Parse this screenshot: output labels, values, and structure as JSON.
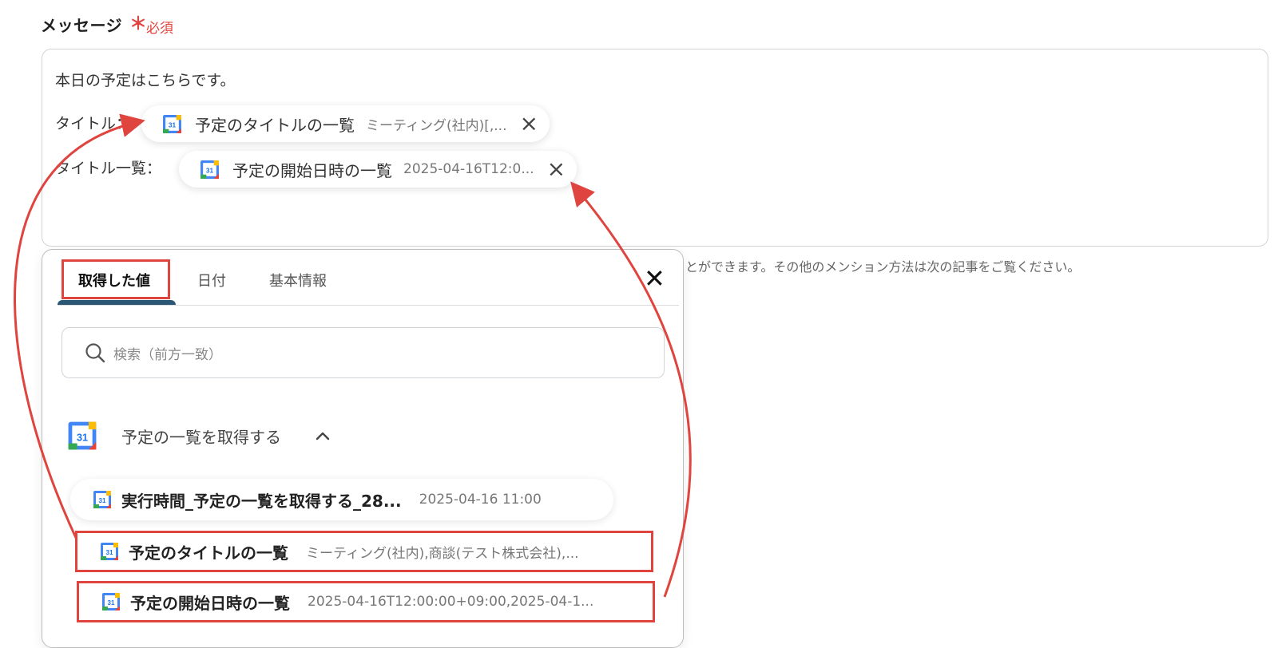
{
  "field": {
    "label": "メッセージ",
    "required_star": "＊",
    "required_text": "必須"
  },
  "editor": {
    "line1": "本日の予定はこちらです。",
    "row1_label": "タイトル：",
    "row2_label": "タイトル一覧：",
    "chips": [
      {
        "icon": "google-calendar-icon",
        "name": "予定のタイトルの一覧",
        "value": "ミーティング(社内)[,..."
      },
      {
        "icon": "google-calendar-icon",
        "name": "予定の開始日時の一覧",
        "value": "2025-04-16T12:0..."
      }
    ]
  },
  "helper_text": "とができます。その他のメンション方法は次の記事をご覧ください。",
  "panel": {
    "tabs": [
      {
        "label": "取得した値",
        "active": true
      },
      {
        "label": "日付",
        "active": false
      },
      {
        "label": "基本情報",
        "active": false
      }
    ],
    "close_icon": "close-icon",
    "search_placeholder": "検索（前方一致）",
    "section": {
      "icon_text": "31",
      "title": "予定の一覧を取得する",
      "expanded": true
    },
    "items": [
      {
        "name": "実行時間_予定の一覧を取得する_28...",
        "value": "2025-04-16 11:00",
        "highlighted": false
      },
      {
        "name": "予定のタイトルの一覧",
        "value": "ミーティング(社内),商談(テスト株式会社),...",
        "highlighted": true
      },
      {
        "name": "予定の開始日時の一覧",
        "value": "2025-04-16T12:00:00+09:00,2025-04-1...",
        "highlighted": true
      }
    ]
  },
  "colors": {
    "highlight": "#e0443e",
    "tab_underline": "#2b5774",
    "required": "#e0443e"
  }
}
